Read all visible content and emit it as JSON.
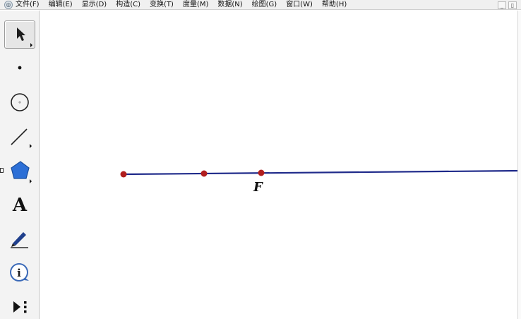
{
  "menu": {
    "items": [
      "文件(F)",
      "编辑(E)",
      "显示(D)",
      "构造(C)",
      "变换(T)",
      "度量(M)",
      "数据(N)",
      "绘图(G)",
      "窗口(W)",
      "帮助(H)"
    ],
    "window_controls": [
      "_",
      "▯"
    ]
  },
  "toolbox": {
    "tools": [
      "arrow-select",
      "point",
      "compass",
      "straightedge",
      "polygon",
      "text",
      "marker",
      "information",
      "custom-tools"
    ],
    "text_tool_label": "A"
  },
  "canvas": {
    "point_label": "F",
    "colors": {
      "line": "#1f2a8a",
      "point": "#b11e1e"
    }
  }
}
